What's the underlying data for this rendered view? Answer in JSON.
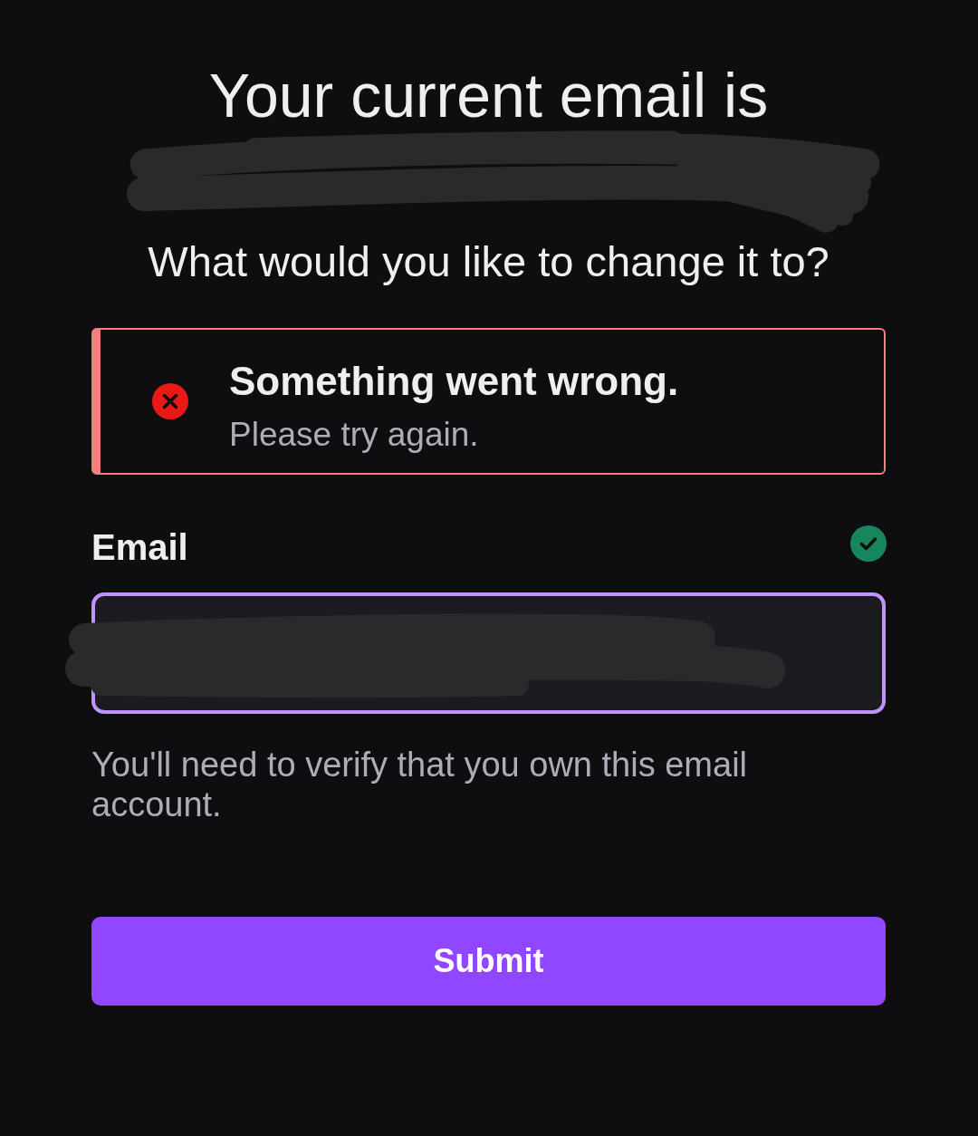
{
  "heading": "Your current email is",
  "current_email": {
    "redacted": true
  },
  "prompt": "What would you like to change it to?",
  "alert": {
    "kind": "error",
    "title": "Something went wrong.",
    "message": "Please try again."
  },
  "email_field": {
    "label": "Email",
    "valid": true,
    "focused": true,
    "redacted": true
  },
  "helper_text": "You'll need to verify that you own this email account.",
  "submit_button": {
    "label": "Submit"
  }
}
